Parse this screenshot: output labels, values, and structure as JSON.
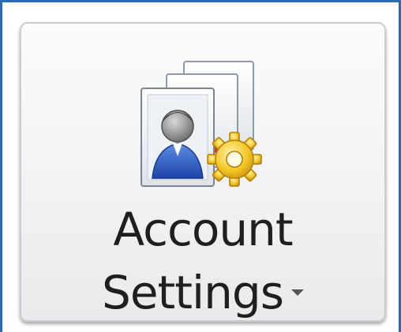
{
  "button": {
    "label_line_1": "Account",
    "label_line_2": "Settings",
    "icon": "account-settings-icon",
    "has_dropdown": true
  },
  "colors": {
    "frame_border": "#2b6ab5",
    "button_border": "#c9cdd2",
    "text": "#1f1f1f",
    "gear": "#f3c626",
    "person_shirt": "#2f5fc2"
  }
}
